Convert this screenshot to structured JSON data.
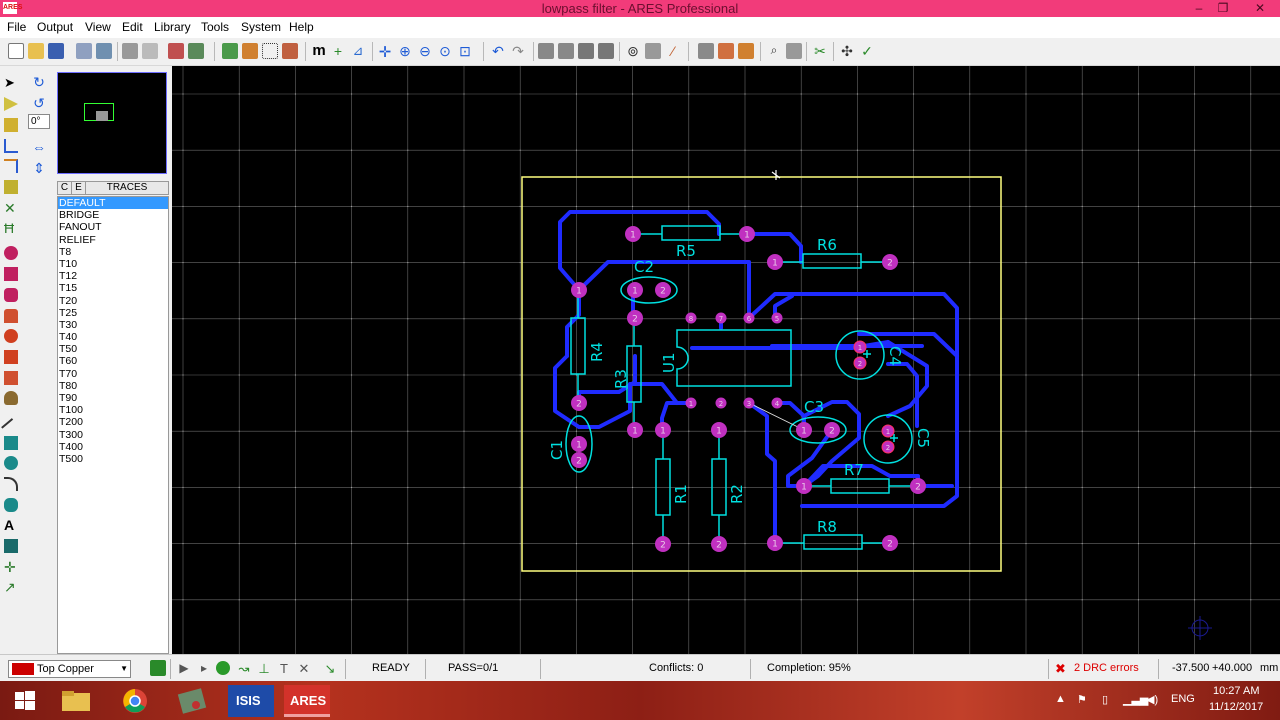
{
  "window": {
    "title": "lowpass filter - ARES Professional",
    "app_icon": "ARES"
  },
  "menu": [
    "File",
    "Output",
    "View",
    "Edit",
    "Library",
    "Tools",
    "System",
    "Help"
  ],
  "panel": {
    "rotation": "0°",
    "headers": {
      "c": "C",
      "e": "E",
      "title": "TRACES"
    },
    "traces": [
      "DEFAULT",
      "BRIDGE",
      "FANOUT",
      "RELIEF",
      "T8",
      "T10",
      "T12",
      "T15",
      "T20",
      "T25",
      "T30",
      "T40",
      "T50",
      "T60",
      "T70",
      "T80",
      "T90",
      "T100",
      "T200",
      "T300",
      "T400",
      "T500"
    ],
    "selected": "DEFAULT"
  },
  "pcb": {
    "labels": {
      "R5": "R5",
      "R6": "R6",
      "C2": "C2",
      "R4": "R4",
      "R3": "R3",
      "U1": "U1",
      "C4": "C4",
      "C3": "C3",
      "C5": "C5",
      "C1": "C1",
      "R7": "R7",
      "R1": "R1",
      "R2": "R2",
      "R8": "R8"
    },
    "pin1": "1",
    "pin2": "2",
    "ic_pins": [
      "8",
      "7",
      "6",
      "5",
      "1",
      "2",
      "3",
      "4"
    ],
    "colors": {
      "board": "#ffff80",
      "trace": "#1f2bff",
      "pad": "#c030c0",
      "silk": "#00e0e0",
      "grid": "#6a6a6a"
    }
  },
  "status": {
    "layer": "Top Copper",
    "state": "READY",
    "pass": "PASS=0/1",
    "conflicts": "Conflicts: 0",
    "completion": "Completion: 95%",
    "drc": "2 DRC errors",
    "coord_x": "-37.500",
    "coord_y": "+40.000",
    "unit": "mm"
  },
  "taskbar": {
    "isis": "ISIS",
    "ares": "ARES",
    "lang": "ENG",
    "time": "10:27 AM",
    "date": "11/12/2017"
  }
}
